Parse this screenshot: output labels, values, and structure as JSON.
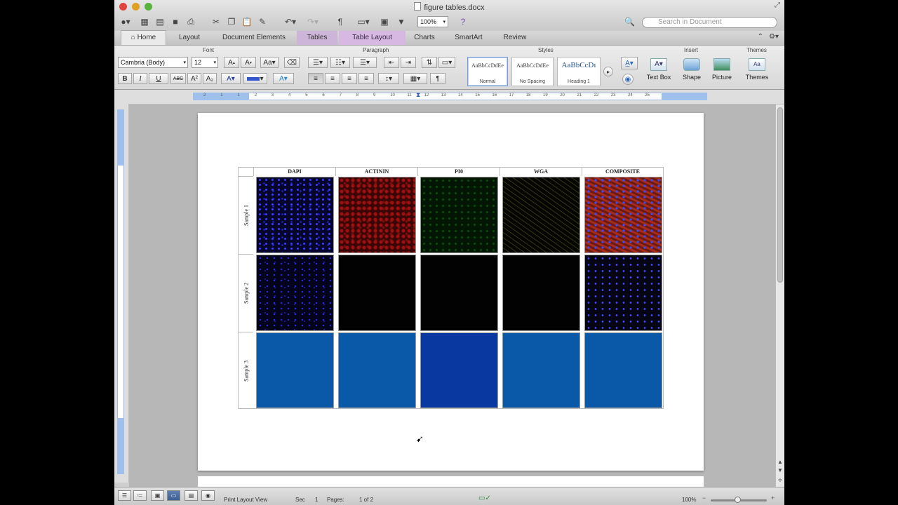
{
  "window": {
    "title": "figure tables.docx",
    "search_placeholder": "Search in Document",
    "zoom": "100%"
  },
  "colors": {
    "table_layout_tab": "#d7b8e2",
    "ruler_margin": "#9fc0ec",
    "selected_view": "#3d5e92"
  },
  "ribbon_tabs": [
    {
      "label": "Home"
    },
    {
      "label": "Layout"
    },
    {
      "label": "Document Elements"
    },
    {
      "label": "Tables"
    },
    {
      "label": "Table Layout"
    },
    {
      "label": "Charts"
    },
    {
      "label": "SmartArt"
    },
    {
      "label": "Review"
    }
  ],
  "ribbon": {
    "groups": {
      "font": "Font",
      "paragraph": "Paragraph",
      "styles": "Styles",
      "insert": "Insert",
      "themes": "Themes"
    },
    "font_name": "Cambria (Body)",
    "font_size": "12",
    "format_labels": {
      "bold": "B",
      "italic": "I",
      "underline": "U",
      "strike": "ABC",
      "grow": "A",
      "shrink": "A"
    },
    "styles": [
      {
        "sample": "AaBbCcDdEe",
        "name": "Normal"
      },
      {
        "sample": "AaBbCcDdEe",
        "name": "No Spacing"
      },
      {
        "sample": "AaBbCcDı",
        "name": "Heading 1"
      }
    ],
    "insert_buttons": [
      "Text Box",
      "Shape",
      "Picture"
    ],
    "themes_button": "Themes"
  },
  "ruler_ticks": [
    "2",
    "1",
    "1",
    "2",
    "3",
    "4",
    "5",
    "6",
    "7",
    "8",
    "9",
    "10",
    "11",
    "12",
    "13",
    "14",
    "15",
    "16",
    "17",
    "18",
    "19",
    "20",
    "21",
    "22",
    "23",
    "24",
    "25"
  ],
  "figure_table": {
    "columns": [
      "DAPI",
      "ACTININ",
      "PI0",
      "WGA",
      "COMPOSITE"
    ],
    "rows": [
      "Sample 1",
      "Sample 2",
      "Sample 3"
    ]
  },
  "statusbar": {
    "view": "Print Layout View",
    "sec_label": "Sec",
    "sec_value": "1",
    "pages_label": "Pages:",
    "pages_value": "1 of 2",
    "zoom": "100%"
  }
}
